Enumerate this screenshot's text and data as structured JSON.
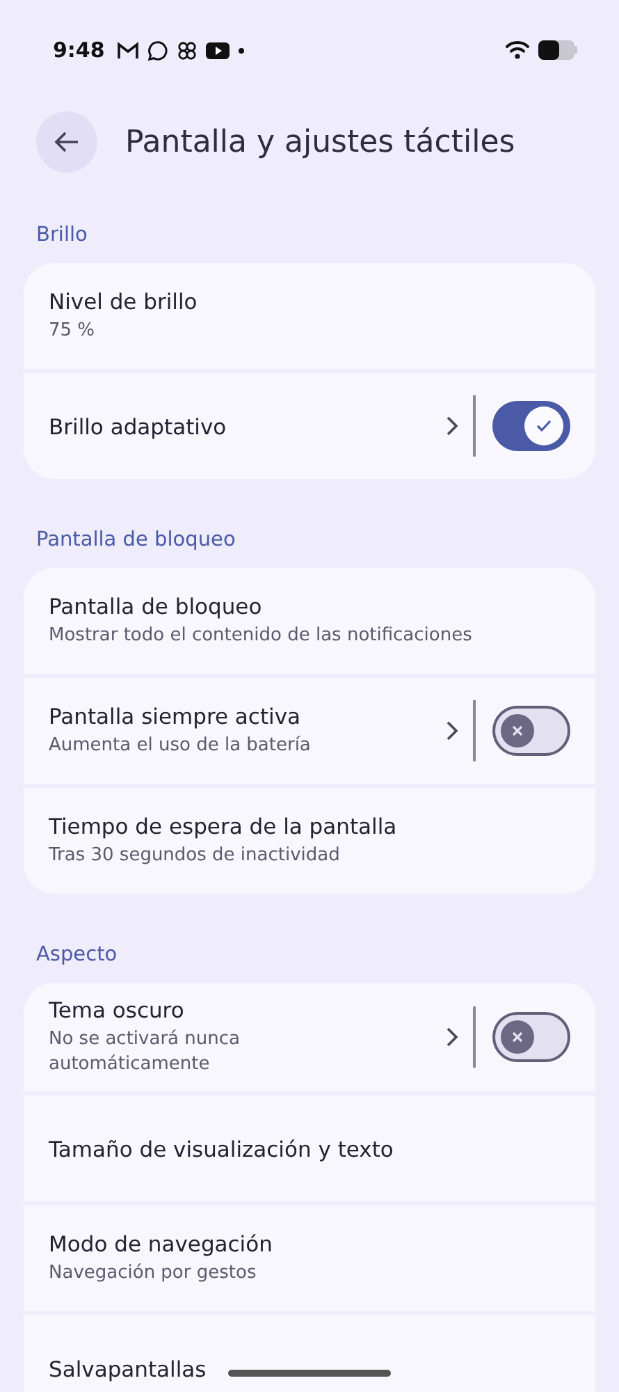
{
  "status_bar": {
    "time": "9:48"
  },
  "header": {
    "title": "Pantalla y ajustes táctiles"
  },
  "sections": [
    {
      "label": "Brillo",
      "items": [
        {
          "kind": "plain",
          "title": "Nivel de brillo",
          "subtitle": "75 %"
        },
        {
          "kind": "toggle",
          "title": "Brillo adaptativo",
          "on": true
        }
      ]
    },
    {
      "label": "Pantalla de bloqueo",
      "items": [
        {
          "kind": "plain",
          "title": "Pantalla de bloqueo",
          "subtitle": "Mostrar todo el contenido de las notificaciones"
        },
        {
          "kind": "toggle",
          "title": "Pantalla siempre activa",
          "subtitle": "Aumenta el uso de la batería",
          "on": false
        },
        {
          "kind": "plain",
          "title": "Tiempo de espera de la pantalla",
          "subtitle": "Tras 30 segundos de inactividad"
        }
      ]
    },
    {
      "label": "Aspecto",
      "items": [
        {
          "kind": "toggle",
          "title": "Tema oscuro",
          "subtitle": "No se activará nunca automáticamente",
          "on": false
        },
        {
          "kind": "plain",
          "title": "Tamaño de visualización y texto"
        },
        {
          "kind": "plain",
          "title": "Modo de navegación",
          "subtitle": "Navegación por gestos"
        },
        {
          "kind": "plain",
          "title": "Salvapantallas"
        }
      ]
    }
  ]
}
